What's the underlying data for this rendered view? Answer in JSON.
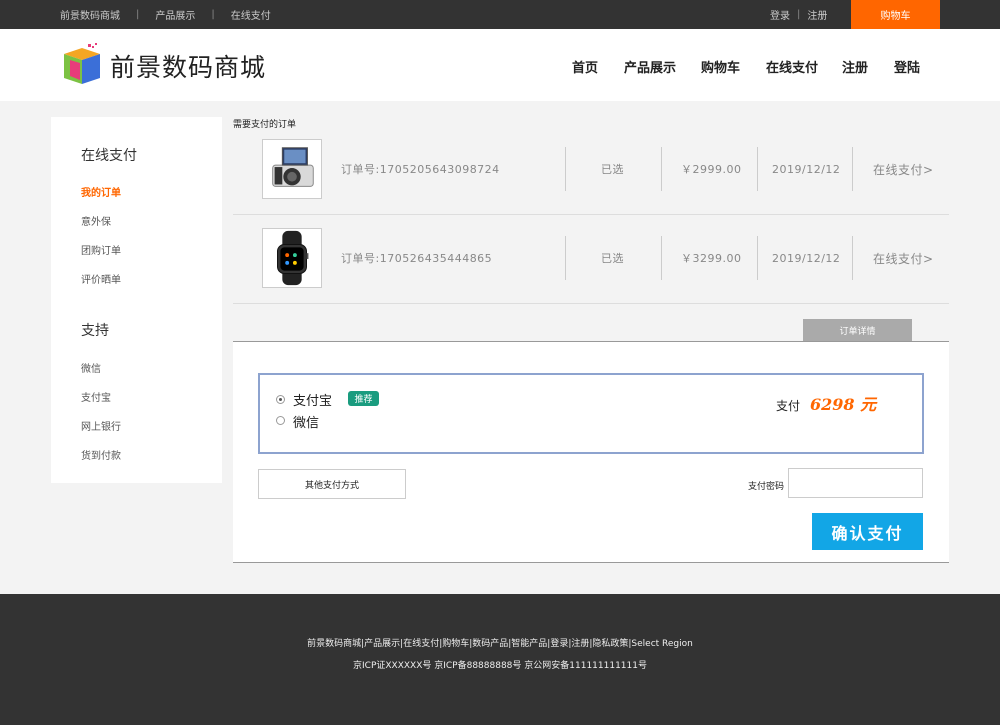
{
  "topbar": {
    "links": [
      "前景数码商城",
      "产品展示",
      "在线支付"
    ],
    "login": "登录",
    "register": "注册",
    "cart": "购物车"
  },
  "header": {
    "brand": "前景数码商城",
    "nav": [
      "首页",
      "产品展示",
      "购物车",
      "在线支付",
      "注册",
      "登陆"
    ]
  },
  "sidebar": {
    "section1_title": "在线支付",
    "section1_items": [
      "我的订单",
      "意外保",
      "团购订单",
      "评价晒单"
    ],
    "section2_title": "支持",
    "section2_items": [
      "微信",
      "支付宝",
      "网上银行",
      "货到付款"
    ]
  },
  "orders": {
    "title": "需要支付的订单",
    "rows": [
      {
        "order_no": "订单号:1705205643098724",
        "status": "已选",
        "price": "￥2999.00",
        "date": "2019/12/12",
        "action": "在线支付>",
        "image": "camera-image"
      },
      {
        "order_no": "订单号:170526435444865",
        "status": "已选",
        "price": "￥3299.00",
        "date": "2019/12/12",
        "action": "在线支付>",
        "image": "smartwatch-image"
      }
    ]
  },
  "tab": {
    "label": "订单详情"
  },
  "payment": {
    "option1": "支付宝",
    "option1_badge": "推荐",
    "option2": "微信",
    "selected": "支付宝",
    "pay_label": "支付",
    "amount": "6298 元",
    "other_methods": "其他支付方式",
    "password_label": "支付密码",
    "password_value": "",
    "confirm": "确认支付"
  },
  "footer": {
    "links": "前景数码商城|产品展示|在线支付|购物车|数码产品|智能产品|登录|注册|隐私政策|Select Region",
    "icp": "京ICP证XXXXXX号 京ICP备88888888号 京公网安备111111111111号"
  },
  "colors": {
    "accent": "#ff6600",
    "confirm": "#12a6e6",
    "badge": "#1a9c7f",
    "topbar": "#333333"
  }
}
